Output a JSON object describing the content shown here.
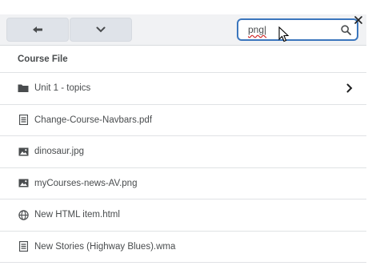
{
  "toolbar": {
    "back_icon": "arrow-left-icon",
    "more_icon": "chevron-down-icon"
  },
  "search": {
    "value": "png|",
    "icon": "search-icon"
  },
  "close_icon": "close-icon",
  "list": {
    "header": "Course File",
    "items": [
      {
        "label": "Unit 1 - topics",
        "icon": "folder-icon",
        "has_children": true
      },
      {
        "label": "Change-Course-Navbars.pdf",
        "icon": "document-icon",
        "has_children": false
      },
      {
        "label": "dinosaur.jpg",
        "icon": "image-icon",
        "has_children": false
      },
      {
        "label": "myCourses-news-AV.png",
        "icon": "image-icon",
        "has_children": false
      },
      {
        "label": "New HTML item.html",
        "icon": "globe-icon",
        "has_children": false
      },
      {
        "label": "New Stories (Highway Blues).wma",
        "icon": "document-icon",
        "has_children": false
      }
    ]
  }
}
